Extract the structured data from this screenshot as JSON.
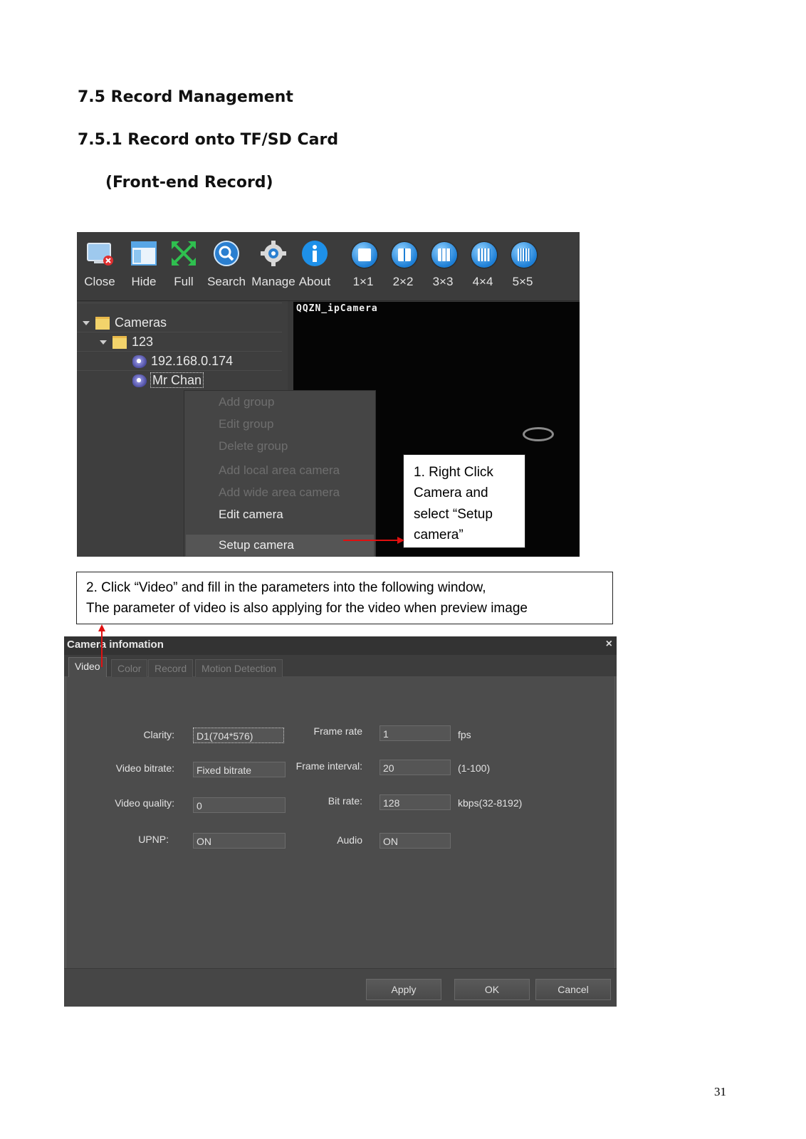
{
  "headings": {
    "h1": "7.5 Record Management",
    "h2": "7.5.1 Record onto TF/SD Card",
    "h3": "(Front-end Record)"
  },
  "toolbar": {
    "buttons": [
      {
        "label": "Close",
        "icon": "monitor-close-icon"
      },
      {
        "label": "Hide",
        "icon": "window-hide-icon"
      },
      {
        "label": "Full",
        "icon": "fullscreen-arrows-icon"
      },
      {
        "label": "Search",
        "icon": "magnifier-icon"
      },
      {
        "label": "Manage",
        "icon": "gear-icon"
      },
      {
        "label": "About",
        "icon": "info-icon"
      },
      {
        "label": "1×1",
        "icon": "grid-1x1-icon"
      },
      {
        "label": "2×2",
        "icon": "grid-2x2-icon"
      },
      {
        "label": "3×3",
        "icon": "grid-3x3-icon"
      },
      {
        "label": "4×4",
        "icon": "grid-4x4-icon"
      },
      {
        "label": "5×5",
        "icon": "grid-5x5-icon"
      }
    ]
  },
  "tree": {
    "root": "Cameras",
    "group": "123",
    "cameras": [
      "192.168.0.174",
      "Mr Chan"
    ]
  },
  "video": {
    "osd": "QQZN_ipCamera"
  },
  "context_menu": {
    "items": [
      {
        "label": "Add group",
        "enabled": false
      },
      {
        "label": "Edit group",
        "enabled": false
      },
      {
        "label": "Delete group",
        "enabled": false
      },
      {
        "label": "Add local area camera",
        "enabled": false
      },
      {
        "label": "Add wide area camera",
        "enabled": false
      },
      {
        "label": "Edit camera",
        "enabled": true
      },
      {
        "label": "Setup camera",
        "enabled": true
      }
    ]
  },
  "callout1": {
    "lines": [
      "1.  Right  Click",
      "Camera     and",
      "select   “Setup",
      "camera”"
    ]
  },
  "callout2": {
    "line1": "2. Click “Video” and fill in the parameters into the following window,",
    "line2": "The parameter of video is also applying for the video when preview image"
  },
  "dialog": {
    "title": "Camera infomation",
    "close": "×",
    "tabs": [
      "Video",
      "Color",
      "Record",
      "Motion Detection"
    ],
    "active_tab": "Video",
    "fields": {
      "clarity": {
        "label": "Clarity:",
        "value": "D1(704*576)"
      },
      "video_bitrate": {
        "label": "Video bitrate:",
        "value": "Fixed bitrate"
      },
      "video_quality": {
        "label": "Video quality:",
        "value": "0"
      },
      "upnp": {
        "label": "UPNP:",
        "value": "ON"
      },
      "frame_rate": {
        "label": "Frame rate",
        "value": "1",
        "unit": "fps"
      },
      "frame_interval": {
        "label": "Frame interval:",
        "value": "20",
        "unit": "(1-100)"
      },
      "bit_rate": {
        "label": "Bit rate:",
        "value": "128",
        "unit": "kbps(32-8192)"
      },
      "audio": {
        "label": "Audio",
        "value": "ON"
      }
    },
    "buttons": {
      "apply": "Apply",
      "ok": "OK",
      "cancel": "Cancel"
    }
  },
  "page_number": "31",
  "colors": {
    "annotation_arrow": "#e01010",
    "toolbar_icon_blue": "#1d7fd6"
  }
}
